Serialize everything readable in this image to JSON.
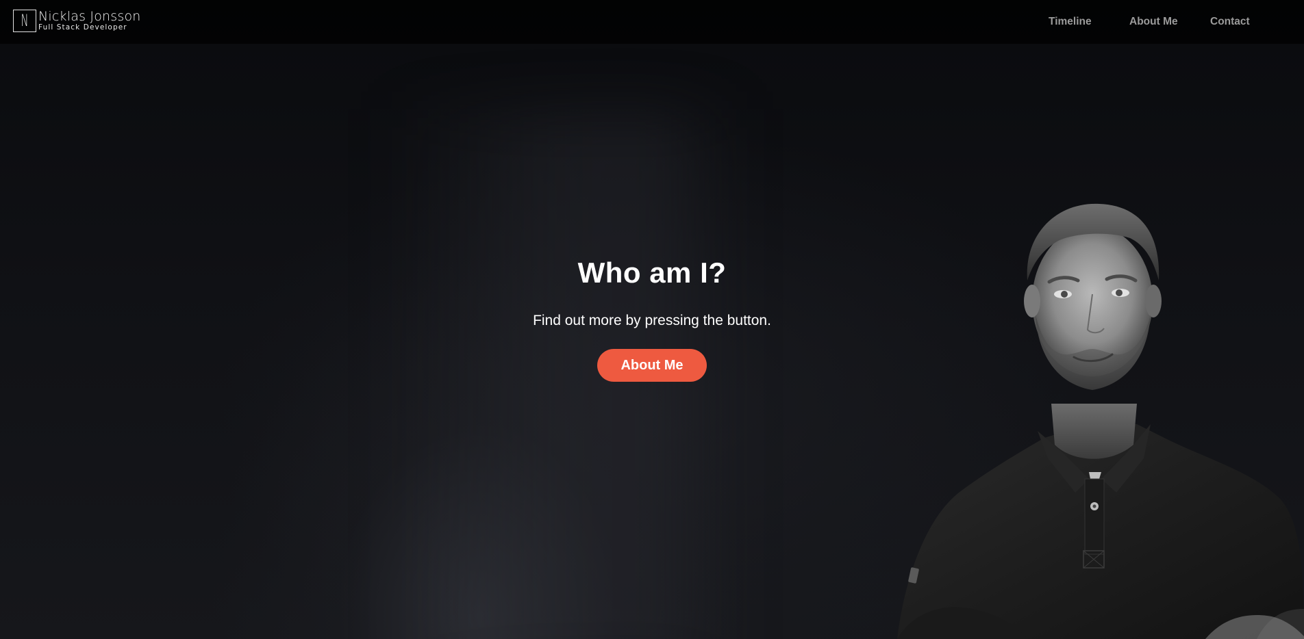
{
  "header": {
    "logo_letter": "N",
    "brand_name": "Nicklas Jonsson",
    "brand_subtitle": "Full Stack Developer",
    "nav": [
      {
        "label": "Timeline"
      },
      {
        "label": "About Me"
      },
      {
        "label": "Contact"
      }
    ]
  },
  "hero": {
    "title": "Who am I?",
    "subtitle": "Find out more by pressing the button.",
    "button_label": "About Me",
    "button_color": "#ee5a40"
  },
  "portrait": {
    "description_icon": "portrait-photo"
  }
}
